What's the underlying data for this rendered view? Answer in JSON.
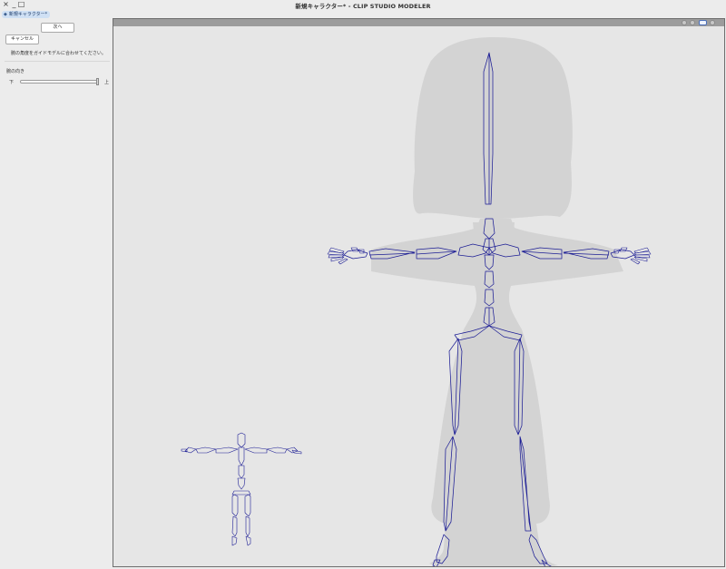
{
  "window": {
    "title": "新規キャラクター* - CLIP STUDIO MODELER",
    "close_glyph": "×",
    "minimize_glyph": "_",
    "maximize_glyph": "□"
  },
  "document_tab": {
    "label": "新規キャラクター*",
    "icon": "character-icon"
  },
  "panel": {
    "next_label": "次へ",
    "cancel_label": "キャンセル",
    "instruction": "腕の角度をガイドモデルに合わせてください。",
    "direction_label": "腕の向き",
    "slider_min_label": "下",
    "slider_max_label": "上",
    "slider_value": 1.0
  },
  "viewport": {
    "header_icons": [
      "view-mode-icon",
      "camera-icon",
      "settings-icon",
      "expand-icon"
    ],
    "colors": {
      "background": "#e6e6e6",
      "guide_silhouette": "#d3d3d3",
      "bone_wireframe": "#1d1e95"
    }
  }
}
